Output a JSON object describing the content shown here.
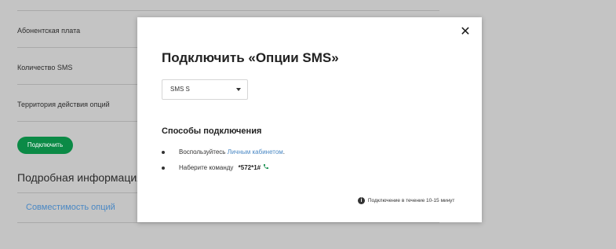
{
  "background": {
    "rows": [
      {
        "label": "Абонентская плата"
      },
      {
        "label": "Количество SMS"
      },
      {
        "label": "Территория действия опций"
      }
    ],
    "connect_button": "Подключить",
    "details_heading": "Подробная информация",
    "compat_link": "Совместимость опций"
  },
  "modal": {
    "title": "Подключить «Опции SMS»",
    "close_icon": "close-icon",
    "select": {
      "value": "SMS S"
    },
    "methods_title": "Способы подключения",
    "methods": {
      "cabinet_prefix": "Воспользуйтесь",
      "cabinet_link": "Личным кабинетом",
      "cabinet_suffix": ".",
      "command_prefix": "Наберите команду",
      "command_code": "*572*1#"
    },
    "info_text": "Подключение в течение 10-15 минут"
  },
  "colors": {
    "overlay": "#c4c4c4",
    "accent_green": "#0b8a46",
    "link_blue": "#4a88c4"
  }
}
